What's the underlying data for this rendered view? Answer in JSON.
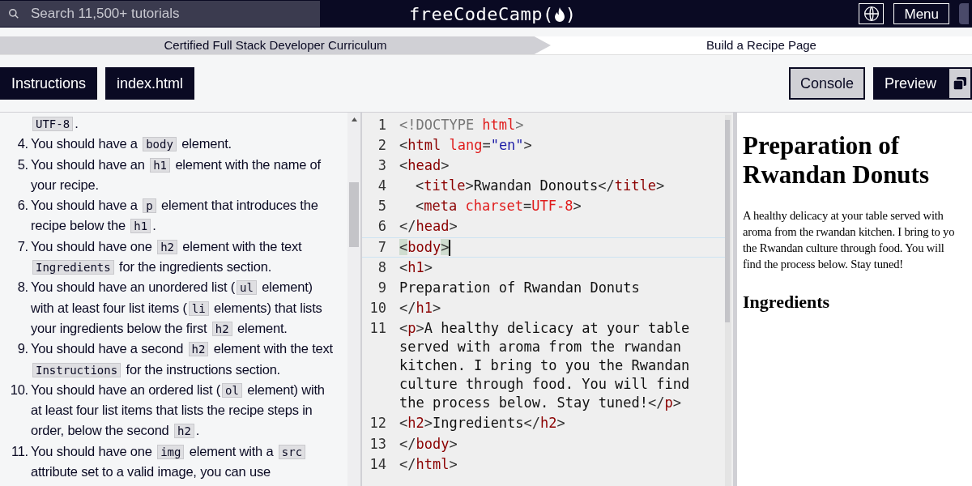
{
  "header": {
    "search": {
      "placeholder": "Search 11,500+ tutorials"
    },
    "logo": {
      "before": "freeCodeCamp(",
      "after": ")"
    },
    "menu_button": "Menu"
  },
  "breadcrumb": {
    "curriculum": "Certified Full Stack Developer Curriculum",
    "project": "Build a Recipe Page"
  },
  "left_tabs": [
    {
      "label": "Instructions",
      "selected": true
    },
    {
      "label": "index.html",
      "selected": true
    }
  ],
  "right_tabs": [
    {
      "label": "Console",
      "selected": false
    },
    {
      "label": "Preview",
      "selected": true
    }
  ],
  "instructions": [
    {
      "parts": [
        {
          "kind": "code",
          "text": "UTF-8"
        },
        {
          "kind": "text",
          "text": "."
        }
      ]
    },
    {
      "number": "4.",
      "parts": [
        {
          "kind": "text",
          "text": "You should have a "
        },
        {
          "kind": "code",
          "text": "body"
        },
        {
          "kind": "text",
          "text": " element."
        }
      ]
    },
    {
      "number": "5.",
      "parts": [
        {
          "kind": "text",
          "text": "You should have an "
        },
        {
          "kind": "code",
          "text": "h1"
        },
        {
          "kind": "text",
          "text": " element with the name of your recipe."
        }
      ]
    },
    {
      "number": "6.",
      "parts": [
        {
          "kind": "text",
          "text": "You should have a "
        },
        {
          "kind": "code",
          "text": "p"
        },
        {
          "kind": "text",
          "text": " element that introduces the recipe below the "
        },
        {
          "kind": "code",
          "text": "h1"
        },
        {
          "kind": "text",
          "text": "."
        }
      ]
    },
    {
      "number": "7.",
      "parts": [
        {
          "kind": "text",
          "text": "You should have one "
        },
        {
          "kind": "code",
          "text": "h2"
        },
        {
          "kind": "text",
          "text": " element with the text "
        },
        {
          "kind": "code",
          "text": "Ingredients"
        },
        {
          "kind": "text",
          "text": " for the ingredients section."
        }
      ]
    },
    {
      "number": "8.",
      "parts": [
        {
          "kind": "text",
          "text": "You should have an unordered list ("
        },
        {
          "kind": "code",
          "text": "ul"
        },
        {
          "kind": "text",
          "text": " element) with at least four list items ("
        },
        {
          "kind": "code",
          "text": "li"
        },
        {
          "kind": "text",
          "text": " elements) that lists your ingredients below the first "
        },
        {
          "kind": "code",
          "text": "h2"
        },
        {
          "kind": "text",
          "text": " element."
        }
      ]
    },
    {
      "number": "9.",
      "parts": [
        {
          "kind": "text",
          "text": "You should have a second "
        },
        {
          "kind": "code",
          "text": "h2"
        },
        {
          "kind": "text",
          "text": " element with the text "
        },
        {
          "kind": "code",
          "text": "Instructions"
        },
        {
          "kind": "text",
          "text": " for the instructions section."
        }
      ]
    },
    {
      "number": "10.",
      "parts": [
        {
          "kind": "text",
          "text": "You should have an ordered list ("
        },
        {
          "kind": "code",
          "text": "ol"
        },
        {
          "kind": "text",
          "text": " element) with at least four list items that lists the recipe steps in order, below the second "
        },
        {
          "kind": "code",
          "text": "h2"
        },
        {
          "kind": "text",
          "text": "."
        }
      ]
    },
    {
      "number": "11.",
      "parts": [
        {
          "kind": "text",
          "text": "You should have one "
        },
        {
          "kind": "code",
          "text": "img"
        },
        {
          "kind": "text",
          "text": " element with a "
        },
        {
          "kind": "code",
          "text": "src"
        },
        {
          "kind": "text",
          "text": " attribute set to a valid image, you can use"
        }
      ]
    }
  ],
  "code_lines": [
    {
      "number": "1",
      "active": false,
      "indented": false,
      "tokens": [
        {
          "kind": "meta",
          "t": "<!DOCTYPE "
        },
        {
          "kind": "attr",
          "t": "html"
        },
        {
          "kind": "meta",
          "t": ">"
        }
      ]
    },
    {
      "number": "2",
      "active": false,
      "indented": false,
      "tokens": [
        {
          "kind": "punct",
          "t": "<"
        },
        {
          "kind": "tag",
          "t": "html "
        },
        {
          "kind": "attr",
          "t": "lang"
        },
        {
          "kind": "punct",
          "t": "="
        },
        {
          "kind": "str",
          "t": "\"en\""
        },
        {
          "kind": "punct",
          "t": ">"
        }
      ]
    },
    {
      "number": "3",
      "active": false,
      "indented": false,
      "tokens": [
        {
          "kind": "punct",
          "t": "<"
        },
        {
          "kind": "tag",
          "t": "head"
        },
        {
          "kind": "punct",
          "t": ">"
        }
      ]
    },
    {
      "number": "4",
      "active": false,
      "indented": true,
      "tokens": [
        {
          "kind": "punct",
          "t": "<"
        },
        {
          "kind": "tag",
          "t": "title"
        },
        {
          "kind": "punct",
          "t": ">"
        },
        {
          "kind": "text",
          "t": "Rwandan Donouts"
        },
        {
          "kind": "punct",
          "t": "</"
        },
        {
          "kind": "tag",
          "t": "title"
        },
        {
          "kind": "punct",
          "t": ">"
        }
      ]
    },
    {
      "number": "5",
      "active": false,
      "indented": true,
      "tokens": [
        {
          "kind": "punct",
          "t": "<"
        },
        {
          "kind": "tag",
          "t": "meta "
        },
        {
          "kind": "attr",
          "t": "charset"
        },
        {
          "kind": "punct",
          "t": "="
        },
        {
          "kind": "attr",
          "t": "UTF-8"
        },
        {
          "kind": "punct",
          "t": ">"
        }
      ]
    },
    {
      "number": "6",
      "active": false,
      "indented": false,
      "tokens": [
        {
          "kind": "punct",
          "t": "</"
        },
        {
          "kind": "tag",
          "t": "head"
        },
        {
          "kind": "punct",
          "t": ">"
        }
      ]
    },
    {
      "number": "7",
      "active": true,
      "indented": false,
      "tokens": [
        {
          "kind": "match",
          "t": "<"
        },
        {
          "kind": "tag",
          "t": "body"
        },
        {
          "kind": "match",
          "t": ">"
        }
      ]
    },
    {
      "number": "8",
      "active": false,
      "indented": false,
      "tokens": [
        {
          "kind": "punct",
          "t": "<"
        },
        {
          "kind": "tag",
          "t": "h1"
        },
        {
          "kind": "punct",
          "t": ">"
        }
      ]
    },
    {
      "number": "9",
      "active": false,
      "indented": false,
      "tokens": [
        {
          "kind": "text",
          "t": "Preparation of Rwandan Donuts"
        }
      ]
    },
    {
      "number": "10",
      "active": false,
      "indented": false,
      "tokens": [
        {
          "kind": "punct",
          "t": "</"
        },
        {
          "kind": "tag",
          "t": "h1"
        },
        {
          "kind": "punct",
          "t": ">"
        }
      ]
    },
    {
      "number": "11",
      "active": false,
      "indented": false,
      "tokens": [
        {
          "kind": "punct",
          "t": "<"
        },
        {
          "kind": "tag",
          "t": "p"
        },
        {
          "kind": "punct",
          "t": ">"
        },
        {
          "kind": "text",
          "t": "A healthy delicacy at your table served with aroma from the rwandan kitchen. I bring to you the Rwandan culture through food. You will find the process below. Stay tuned!"
        },
        {
          "kind": "punct",
          "t": "</"
        },
        {
          "kind": "tag",
          "t": "p"
        },
        {
          "kind": "punct",
          "t": ">"
        }
      ]
    },
    {
      "number": "12",
      "active": false,
      "indented": false,
      "tokens": [
        {
          "kind": "punct",
          "t": "<"
        },
        {
          "kind": "tag",
          "t": "h2"
        },
        {
          "kind": "punct",
          "t": ">"
        },
        {
          "kind": "text",
          "t": "Ingredients"
        },
        {
          "kind": "punct",
          "t": "</"
        },
        {
          "kind": "tag",
          "t": "h2"
        },
        {
          "kind": "punct",
          "t": ">"
        }
      ]
    },
    {
      "number": "13",
      "active": false,
      "indented": false,
      "tokens": [
        {
          "kind": "punct",
          "t": "</"
        },
        {
          "kind": "tag",
          "t": "body"
        },
        {
          "kind": "punct",
          "t": ">"
        }
      ]
    },
    {
      "number": "14",
      "active": false,
      "indented": false,
      "tokens": [
        {
          "kind": "punct",
          "t": "</"
        },
        {
          "kind": "tag",
          "t": "html"
        },
        {
          "kind": "punct",
          "t": ">"
        }
      ]
    }
  ],
  "preview": {
    "heading": "Preparation of Rwandan Donuts",
    "paragraph_lines": [
      "A healthy delicacy at your table served with",
      "aroma from the rwandan kitchen. I bring to yo",
      "the Rwandan culture through food. You will",
      "find the process below. Stay tuned!"
    ],
    "subheading": "Ingredients"
  }
}
